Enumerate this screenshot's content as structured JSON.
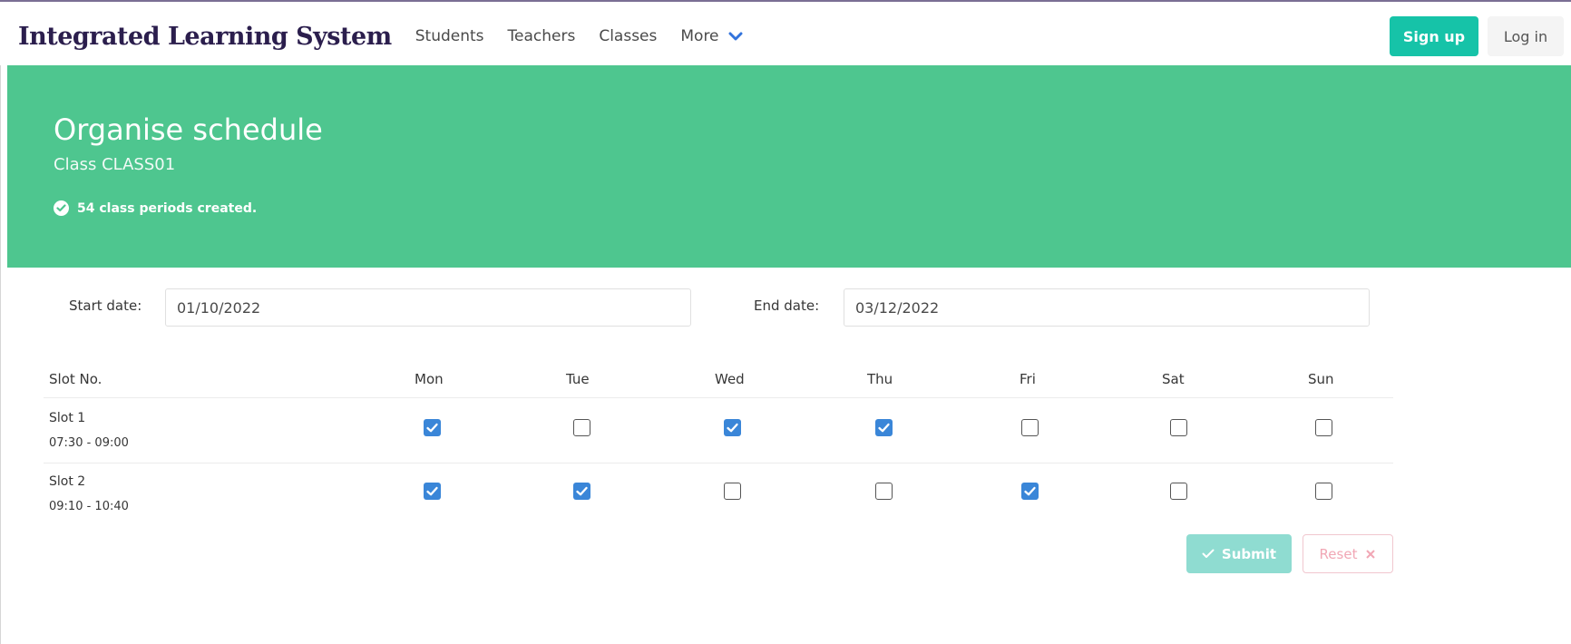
{
  "navbar": {
    "brand": "Integrated Learning System",
    "items": [
      "Students",
      "Teachers",
      "Classes",
      "More"
    ],
    "signup_label": "Sign up",
    "login_label": "Log in"
  },
  "hero": {
    "title": "Organise schedule",
    "subtitle": "Class CLASS01",
    "message": "54 class periods created."
  },
  "form": {
    "start_label": "Start date:",
    "start_value": "01/10/2022",
    "end_label": "End date:",
    "end_value": "03/12/2022"
  },
  "schedule": {
    "slot_header": "Slot No.",
    "days": [
      "Mon",
      "Tue",
      "Wed",
      "Thu",
      "Fri",
      "Sat",
      "Sun"
    ],
    "slots": [
      {
        "name": "Slot 1",
        "time": "07:30 - 09:00",
        "checked": [
          true,
          false,
          true,
          true,
          false,
          false,
          false
        ]
      },
      {
        "name": "Slot 2",
        "time": "09:10 - 10:40",
        "checked": [
          true,
          true,
          false,
          false,
          true,
          false,
          false
        ]
      }
    ]
  },
  "actions": {
    "submit_label": "Submit",
    "reset_label": "Reset"
  },
  "colors": {
    "brand": "#2b1e4d",
    "primary": "#16c3a8",
    "hero": "#4ec68f",
    "checkbox": "#3a86d8"
  }
}
